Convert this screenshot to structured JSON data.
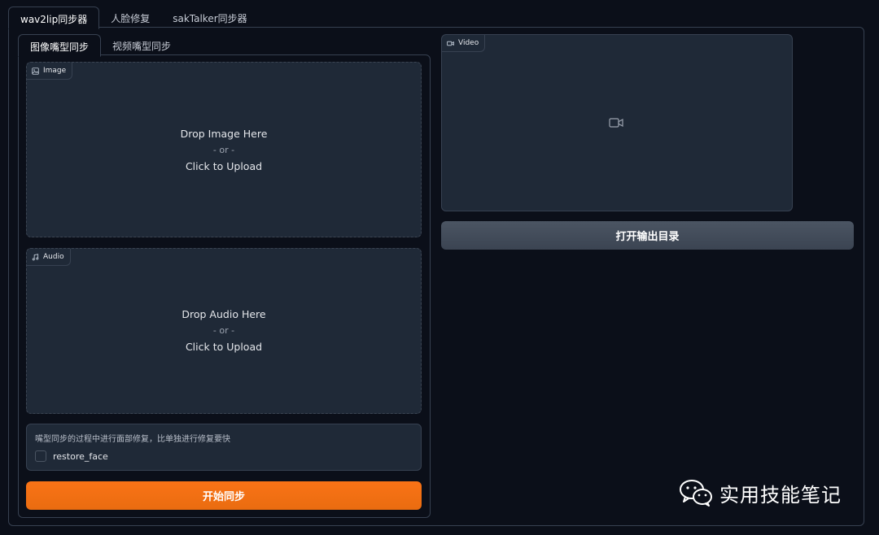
{
  "top_tabs": [
    "wav2lip同步器",
    "人脸修复",
    "sakTalker同步器"
  ],
  "sub_tabs": [
    "图像嘴型同步",
    "视频嘴型同步"
  ],
  "image_upload": {
    "label": "Image",
    "drop_text": "Drop Image Here",
    "or_text": "- or -",
    "click_text": "Click to Upload",
    "icon": "image-icon"
  },
  "audio_upload": {
    "label": "Audio",
    "drop_text": "Drop Audio Here",
    "or_text": "- or -",
    "click_text": "Click to Upload",
    "icon": "music-icon"
  },
  "restore": {
    "info": "嘴型同步的过程中进行面部修复，比单独进行修复要快",
    "checkbox_label": "restore_face",
    "checked": false
  },
  "start_button": "开始同步",
  "video_output": {
    "label": "Video",
    "icon": "video-icon"
  },
  "open_output_button": "打开输出目录",
  "watermark": {
    "text": "实用技能笔记",
    "icon": "wechat-icon"
  },
  "colors": {
    "background": "#0b0f19",
    "block": "#1f2937",
    "primary": "#f97316",
    "secondary": "#4b5563"
  }
}
